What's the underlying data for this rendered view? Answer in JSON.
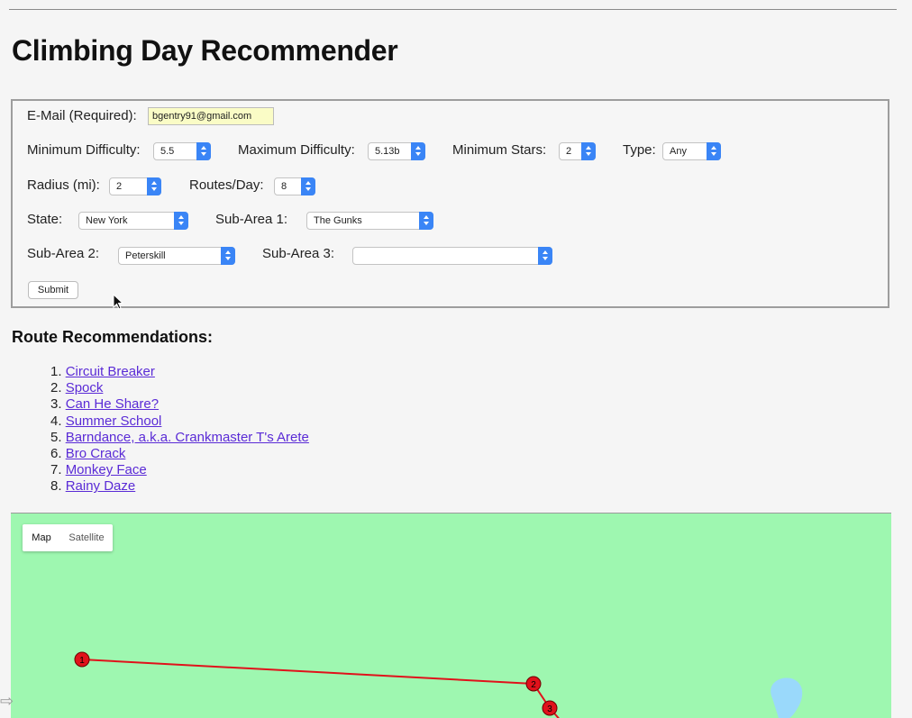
{
  "page": {
    "title": "Climbing Day Recommender"
  },
  "form": {
    "email_label": "E-Mail (Required):",
    "email_value": "bgentry91@gmail.com",
    "min_difficulty_label": "Minimum Difficulty:",
    "min_difficulty_value": "5.5",
    "max_difficulty_label": "Maximum Difficulty:",
    "max_difficulty_value": "5.13b",
    "min_stars_label": "Minimum Stars:",
    "min_stars_value": "2",
    "type_label": "Type:",
    "type_value": "Any",
    "radius_label": "Radius (mi):",
    "radius_value": "2",
    "routes_label": "Routes/Day:",
    "routes_value": "8",
    "state_label": "State:",
    "state_value": "New York",
    "sub1_label": "Sub-Area 1:",
    "sub1_value": "The Gunks",
    "sub2_label": "Sub-Area 2:",
    "sub2_value": "Peterskill",
    "sub3_label": "Sub-Area 3:",
    "sub3_value": "",
    "submit_label": "Submit"
  },
  "results": {
    "heading": "Route Recommendations:",
    "routes": [
      {
        "num": "1.",
        "name": "Circuit Breaker"
      },
      {
        "num": "2.",
        "name": "Spock"
      },
      {
        "num": "3.",
        "name": "Can He Share?"
      },
      {
        "num": "4.",
        "name": "Summer School"
      },
      {
        "num": "5.",
        "name": "Barndance, a.k.a. Crankmaster T's Arete"
      },
      {
        "num": "6.",
        "name": "Bro Crack"
      },
      {
        "num": "7.",
        "name": "Monkey Face "
      },
      {
        "num": "8.",
        "name": "Rainy Daze"
      }
    ]
  },
  "map": {
    "map_tab": "Map",
    "satellite_tab": "Satellite",
    "markers": [
      "1",
      "2",
      "3"
    ],
    "land_color": "#9ef7b0",
    "route_color": "#e0121b",
    "water_color": "#9ad9fb"
  }
}
